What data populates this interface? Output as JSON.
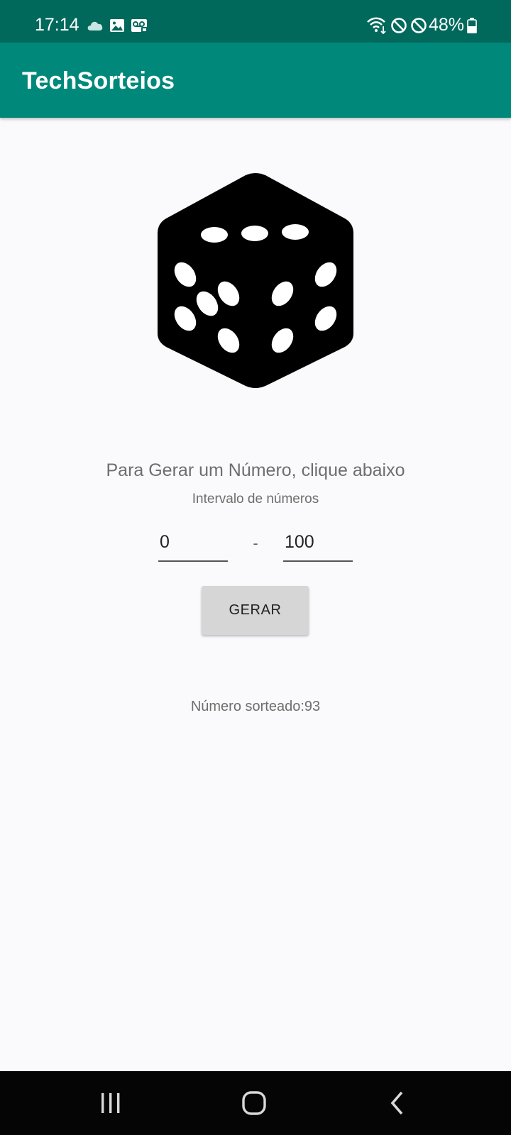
{
  "status_bar": {
    "time": "17:14",
    "battery": "48%",
    "icons_left": [
      "cloud-icon",
      "image-icon",
      "voicemail-icon"
    ],
    "icons_right": [
      "wifi-icon",
      "blocked-icon",
      "blocked-icon",
      "battery-icon"
    ]
  },
  "app_bar": {
    "title": "TechSorteios"
  },
  "main": {
    "dice_icon": "dice-icon",
    "prompt": "Para Gerar um Número, clique abaixo",
    "range_label": "Intervalo de números",
    "min_value": "0",
    "separator": "-",
    "max_value": "100",
    "button_label": "GERAR",
    "result": "Número sorteado:93"
  },
  "nav_bar": {
    "icons": [
      "recents-icon",
      "home-icon",
      "back-icon"
    ]
  },
  "colors": {
    "status_bar": "#00695c",
    "app_bar": "#00897b",
    "background": "#faf9fb",
    "button": "#d6d6d6",
    "nav_bar": "#050505"
  }
}
